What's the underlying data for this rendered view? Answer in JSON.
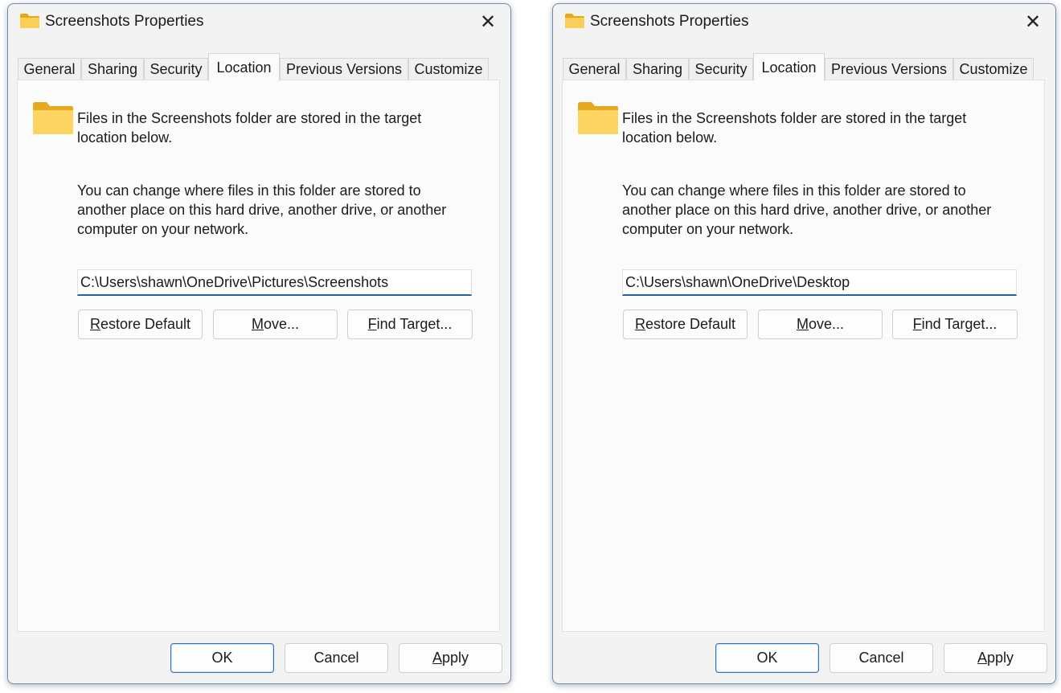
{
  "colors": {
    "accent": "#2a5ea8",
    "folder": "#f7c948"
  },
  "dialogs": [
    {
      "title": "Screenshots Properties",
      "tabs": [
        "General",
        "Sharing",
        "Security",
        "Location",
        "Previous Versions",
        "Customize"
      ],
      "active_tab": "Location",
      "description": "Files in the Screenshots folder are stored in the target location below.",
      "instructions": "You can change where files in this folder are stored to another place on this hard drive, another drive, or another computer on your network.",
      "path": "C:\\Users\\shawn\\OneDrive\\Pictures\\Screenshots",
      "buttons": {
        "restore_default": {
          "key": "R",
          "rest": "estore Default"
        },
        "move": {
          "key": "M",
          "rest": "ove..."
        },
        "find_target": {
          "key": "F",
          "rest": "ind Target..."
        }
      },
      "footer": {
        "ok": "OK",
        "cancel": "Cancel",
        "apply": {
          "key": "A",
          "rest": "pply"
        }
      }
    },
    {
      "title": "Screenshots Properties",
      "tabs": [
        "General",
        "Sharing",
        "Security",
        "Location",
        "Previous Versions",
        "Customize"
      ],
      "active_tab": "Location",
      "description": "Files in the Screenshots folder are stored in the target location below.",
      "instructions": "You can change where files in this folder are stored to another place on this hard drive, another drive, or another computer on your network.",
      "path": "C:\\Users\\shawn\\OneDrive\\Desktop",
      "buttons": {
        "restore_default": {
          "key": "R",
          "rest": "estore Default"
        },
        "move": {
          "key": "M",
          "rest": "ove..."
        },
        "find_target": {
          "key": "F",
          "rest": "ind Target..."
        }
      },
      "footer": {
        "ok": "OK",
        "cancel": "Cancel",
        "apply": {
          "key": "A",
          "rest": "pply"
        }
      }
    }
  ]
}
